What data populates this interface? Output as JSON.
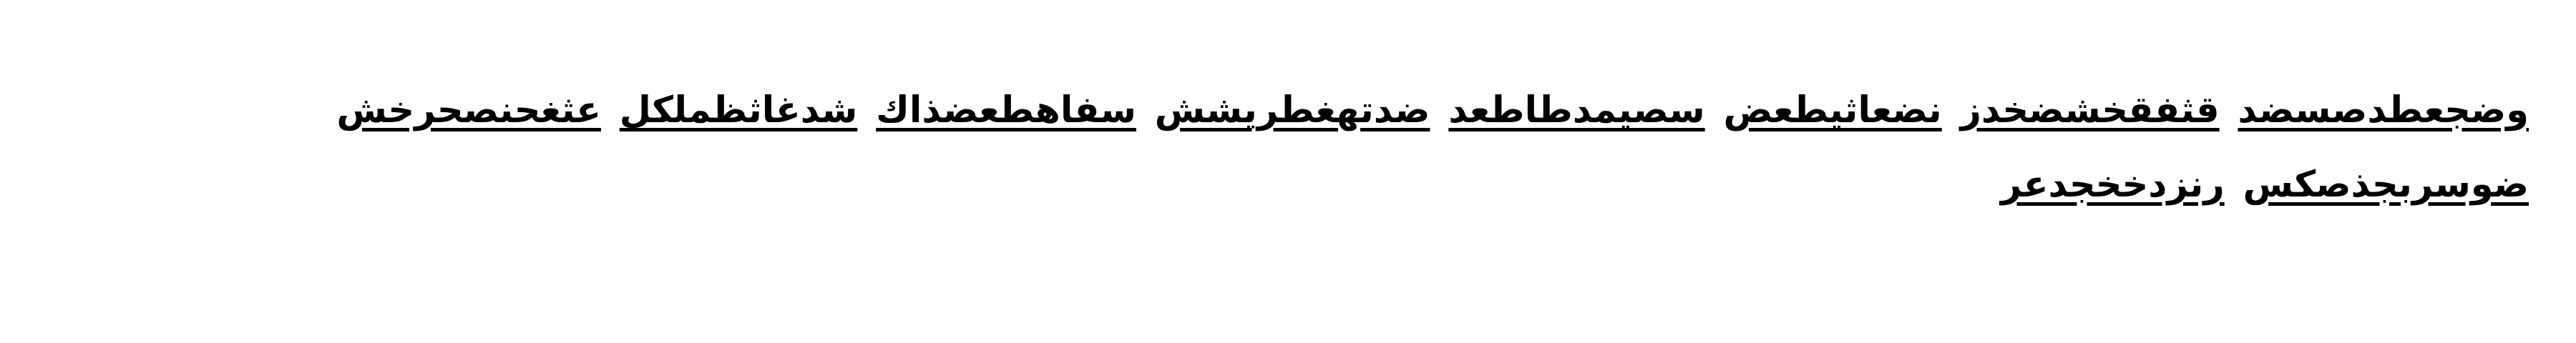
{
  "document": {
    "direction": "rtl",
    "text_color": "#000000",
    "background_color": "#ffffff",
    "paragraph": {
      "words": [
        "وضجعطدصسضد",
        "قثفقخشضخدز",
        "نضعاثيطعض",
        "سصيمدطاطعد",
        "ضدتهغطريشش",
        "سفاهطعضذاك",
        "شدغاثظملكل",
        "عثغحنصحرخش",
        "ضوسربجذصكس",
        "رنزدخخجدعر"
      ]
    }
  }
}
